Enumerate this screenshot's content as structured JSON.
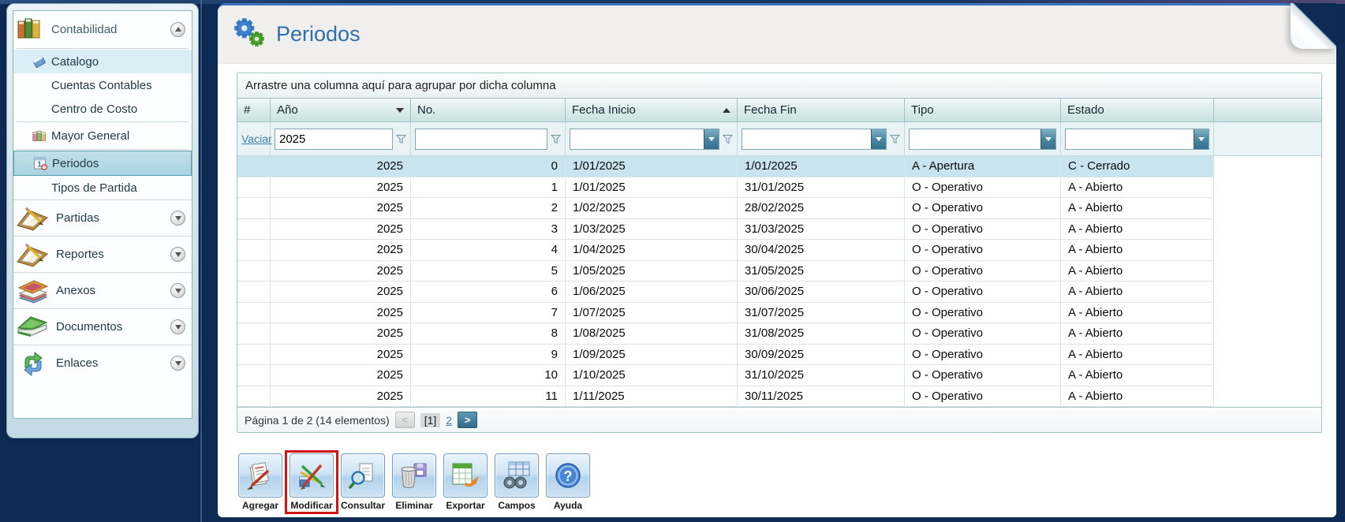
{
  "sidebar": {
    "title": "Contabilidad",
    "items": [
      {
        "label": "Catalogo"
      },
      {
        "label": "Cuentas Contables"
      },
      {
        "label": "Centro de Costo"
      },
      {
        "label": "Mayor General"
      },
      {
        "label": "Periodos"
      },
      {
        "label": "Tipos de Partida"
      }
    ],
    "sections": [
      {
        "label": "Partidas"
      },
      {
        "label": "Reportes"
      },
      {
        "label": "Anexos"
      },
      {
        "label": "Documentos"
      },
      {
        "label": "Enlaces"
      }
    ]
  },
  "main": {
    "title": "Periodos",
    "group_bar_text": "Arrastre una columna aquí para agrupar por dicha columna",
    "grid": {
      "columns": [
        {
          "label": "#"
        },
        {
          "label": "Año",
          "arrow": "down"
        },
        {
          "label": "No."
        },
        {
          "label": "Fecha Inicio",
          "arrow": "up"
        },
        {
          "label": "Fecha Fin"
        },
        {
          "label": "Tipo"
        },
        {
          "label": "Estado"
        }
      ],
      "filter_row": {
        "clear_link": "Vaciar",
        "ano": "2025",
        "no": "",
        "fecha_inicio": "",
        "fecha_fin": "",
        "tipo": "",
        "estado": ""
      },
      "selected_row_index": 0,
      "rows": [
        [
          "2025",
          "0",
          "1/01/2025",
          "1/01/2025",
          "A - Apertura",
          "C - Cerrado"
        ],
        [
          "2025",
          "1",
          "1/01/2025",
          "31/01/2025",
          "O - Operativo",
          "A - Abierto"
        ],
        [
          "2025",
          "2",
          "1/02/2025",
          "28/02/2025",
          "O - Operativo",
          "A - Abierto"
        ],
        [
          "2025",
          "3",
          "1/03/2025",
          "31/03/2025",
          "O - Operativo",
          "A - Abierto"
        ],
        [
          "2025",
          "4",
          "1/04/2025",
          "30/04/2025",
          "O - Operativo",
          "A - Abierto"
        ],
        [
          "2025",
          "5",
          "1/05/2025",
          "31/05/2025",
          "O - Operativo",
          "A - Abierto"
        ],
        [
          "2025",
          "6",
          "1/06/2025",
          "30/06/2025",
          "O - Operativo",
          "A - Abierto"
        ],
        [
          "2025",
          "7",
          "1/07/2025",
          "31/07/2025",
          "O - Operativo",
          "A - Abierto"
        ],
        [
          "2025",
          "8",
          "1/08/2025",
          "31/08/2025",
          "O - Operativo",
          "A - Abierto"
        ],
        [
          "2025",
          "9",
          "1/09/2025",
          "30/09/2025",
          "O - Operativo",
          "A - Abierto"
        ],
        [
          "2025",
          "10",
          "1/10/2025",
          "31/10/2025",
          "O - Operativo",
          "A - Abierto"
        ],
        [
          "2025",
          "11",
          "1/11/2025",
          "30/11/2025",
          "O - Operativo",
          "A - Abierto"
        ]
      ]
    },
    "pager": {
      "summary": "Página 1 de 2 (14 elementos)",
      "prev_label": "<",
      "current": "[1]",
      "page2": "2",
      "next_label": ">"
    },
    "toolbar": [
      {
        "label": "Agregar"
      },
      {
        "label": "Modificar",
        "highlighted": true
      },
      {
        "label": "Consultar"
      },
      {
        "label": "Eliminar"
      },
      {
        "label": "Exportar"
      },
      {
        "label": "Campos"
      },
      {
        "label": "Ayuda"
      }
    ]
  },
  "colors": {
    "background_navy": "#0e2b55",
    "accent_blue": "#2e6fae",
    "selected_row": "#c8e4ee",
    "selected_nav": "#b3d8e4",
    "highlight_red": "#cf1616"
  }
}
